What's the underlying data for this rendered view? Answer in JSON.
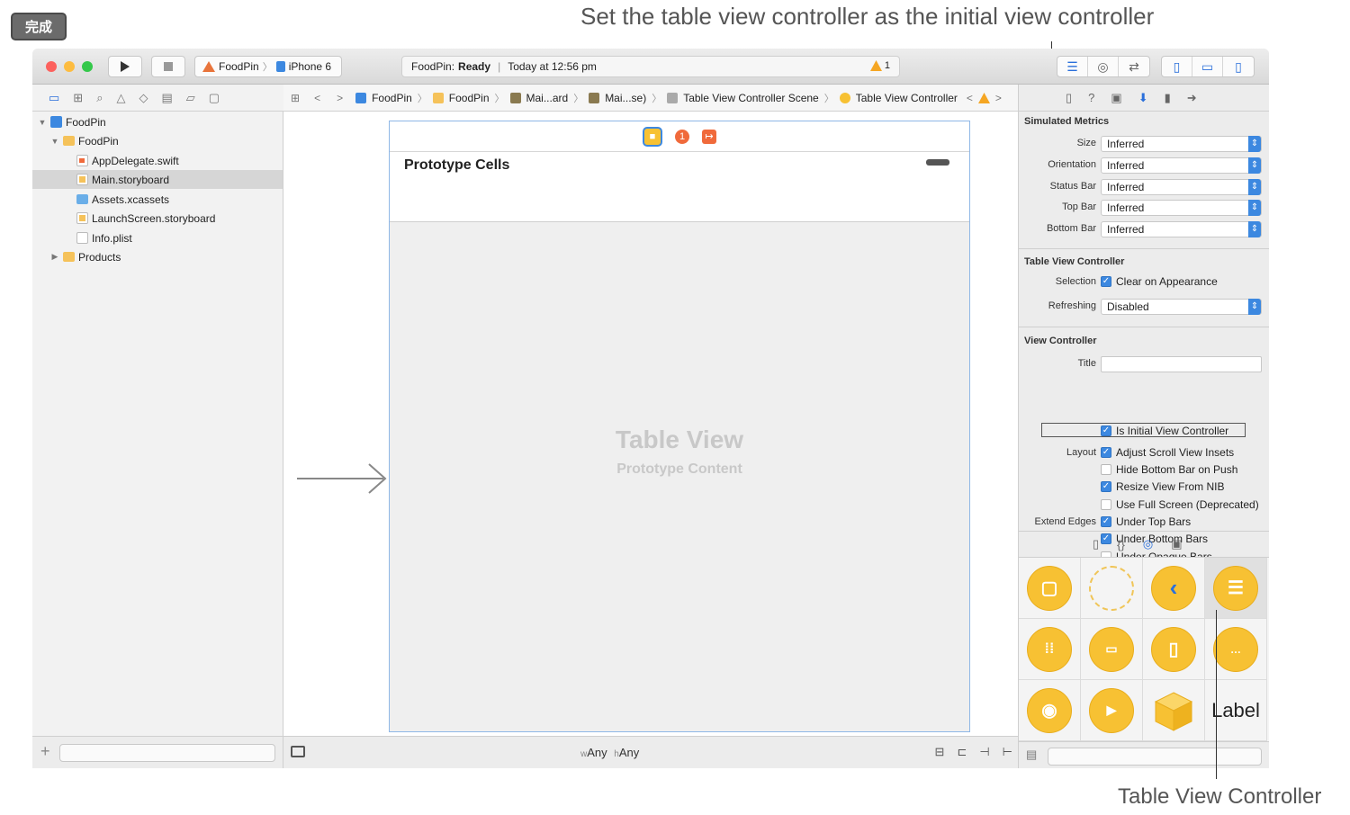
{
  "done_label": "完成",
  "annotations": {
    "top": "Set the table view controller as the initial view controller",
    "bottom": "Table View Controller"
  },
  "toolbar": {
    "scheme_app": "FoodPin",
    "scheme_device": "iPhone 6",
    "status_app": "FoodPin:",
    "status_state": "Ready",
    "status_time": "Today at 12:56 pm",
    "warning_count": "1"
  },
  "navigator": {
    "items": [
      {
        "label": "FoodPin"
      },
      {
        "label": "FoodPin"
      },
      {
        "label": "AppDelegate.swift"
      },
      {
        "label": "Main.storyboard"
      },
      {
        "label": "Assets.xcassets"
      },
      {
        "label": "LaunchScreen.storyboard"
      },
      {
        "label": "Info.plist"
      },
      {
        "label": "Products"
      }
    ]
  },
  "jumpbar": {
    "items": [
      "FoodPin",
      "FoodPin",
      "Mai...ard",
      "Mai...se)",
      "Table View Controller Scene",
      "Table View Controller"
    ]
  },
  "canvas": {
    "prototype_cells": "Prototype Cells",
    "placeholder_title": "Table View",
    "placeholder_sub": "Prototype Content",
    "size_w_prefix": "w",
    "size_w": "Any",
    "size_h_prefix": "h",
    "size_h": "Any"
  },
  "inspector": {
    "simulated_metrics": {
      "header": "Simulated Metrics",
      "rows": [
        {
          "label": "Size",
          "value": "Inferred"
        },
        {
          "label": "Orientation",
          "value": "Inferred"
        },
        {
          "label": "Status Bar",
          "value": "Inferred"
        },
        {
          "label": "Top Bar",
          "value": "Inferred"
        },
        {
          "label": "Bottom Bar",
          "value": "Inferred"
        }
      ]
    },
    "table_view_controller": {
      "header": "Table View Controller",
      "selection_label": "Selection",
      "clear_on_appearance": "Clear on Appearance",
      "refreshing_label": "Refreshing",
      "refreshing_value": "Disabled"
    },
    "view_controller": {
      "header": "View Controller",
      "title_label": "Title",
      "title_value": "",
      "initial_vc": "Is Initial View Controller",
      "layout_label": "Layout",
      "adjust_scroll": "Adjust Scroll View Insets",
      "hide_bottom_bar": "Hide Bottom Bar on Push",
      "resize_nib": "Resize View From NIB",
      "full_screen": "Use Full Screen (Deprecated)",
      "extend_edges_label": "Extend Edges",
      "under_top": "Under Top Bars",
      "under_bottom": "Under Bottom Bars",
      "under_opaque": "Under Opaque Bars"
    },
    "checkboxes": {
      "clear_on_appearance": true,
      "initial_vc": true,
      "adjust_scroll": true,
      "hide_bottom_bar": false,
      "resize_nib": true,
      "full_screen": false,
      "under_top": true,
      "under_bottom": true,
      "under_opaque": false
    }
  },
  "library": {
    "label_item": "Label"
  },
  "colors": {
    "accent": "#3c88e0",
    "library_yellow": "#f7c133"
  }
}
